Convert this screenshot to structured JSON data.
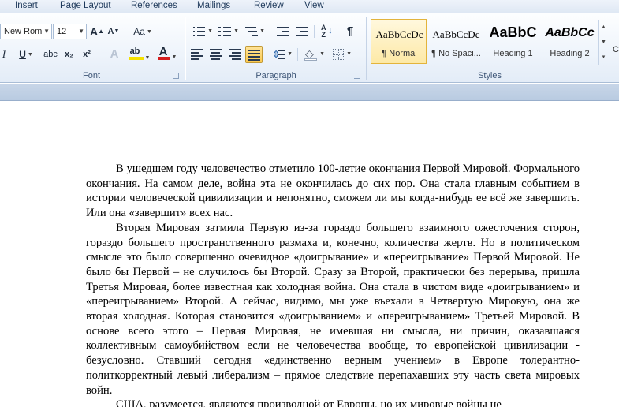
{
  "tabs": [
    "Insert",
    "Page Layout",
    "References",
    "Mailings",
    "Review",
    "View"
  ],
  "font": {
    "name": "New Rom",
    "size": "12",
    "grow_icon": "A",
    "shrink_icon": "A",
    "case_icon": "Aa",
    "italic": "I",
    "underline": "U",
    "strike": "abc",
    "subscript": "x₂",
    "superscript": "x²",
    "effects_icon": "A",
    "highlight": "ab",
    "color_icon": "A",
    "highlight_color": "#f5e100",
    "font_color": "#d51e1e",
    "group_label": "Font"
  },
  "paragraph": {
    "show_marks": "¶",
    "group_label": "Paragraph"
  },
  "styles": {
    "items": [
      {
        "sample": "AaBbCcDc",
        "name": "¶ Normal"
      },
      {
        "sample": "AaBbCcDc",
        "name": "¶ No Spaci..."
      },
      {
        "sample": "AaBbC",
        "name": "Heading 1"
      },
      {
        "sample": "AaBbCc",
        "name": "Heading 2"
      }
    ],
    "group_label": "Styles",
    "change_label": "C"
  },
  "document": {
    "paragraphs": [
      "В ушедшем году человечество отметило 100-летие окончания Первой Мировой. Формального окончания. На самом деле, война эта не окончилась до сих пор. Она стала главным событием в истории человеческой цивилизации и непонятно, сможем ли мы когда-нибудь ее всё же завершить. Или она «завершит» всех нас.",
      "Вторая Мировая затмила Первую из-за гораздо большего взаимного ожесточения сторон, гораздо большего пространственного размаха и, конечно, количества жертв. Но в политическом смысле это было совершенно очевидное «доигрывание» и «переигрывание» Первой Мировой. Не было бы Первой – не случилось бы Второй. Сразу за Второй, практически без перерыва, пришла Третья Мировая, более известная как холодная война. Она стала в чистом виде «доигрыванием» и «переигрыванием» Второй. А сейчас, видимо, мы уже въехали в Четвертую Мировую, она же вторая холодная. Которая становится «доигрыванием» и «переигрыванием» Третьей Мировой. В основе всего этого – Первая Мировая, не имевшая ни смысла, ни причин, оказавшаяся коллективным самоубийством если не человечества вообще, то европейской цивилизации - безусловно. Ставший сегодня «единственно верным учением» в Европе толерантно-политкорректный левый либерализм – прямое следствие перепахавших эту часть света мировых войн.",
      "США, разумеется, являются производной от Европы, но их мировые войны не"
    ]
  }
}
